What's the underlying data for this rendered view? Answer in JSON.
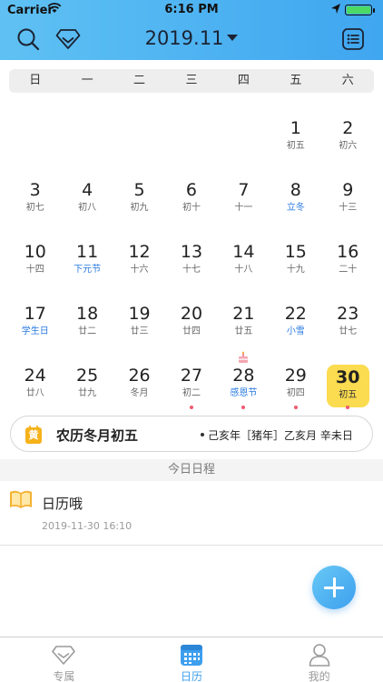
{
  "status_bar": {
    "carrier": "Carrier",
    "time": "6:16 PM"
  },
  "header": {
    "month_title": "2019.11"
  },
  "weekdays": [
    "日",
    "一",
    "二",
    "三",
    "四",
    "五",
    "六"
  ],
  "weeks": [
    [
      {
        "day": "",
        "lunar": ""
      },
      {
        "day": "",
        "lunar": ""
      },
      {
        "day": "",
        "lunar": ""
      },
      {
        "day": "",
        "lunar": ""
      },
      {
        "day": "",
        "lunar": ""
      },
      {
        "day": "1",
        "lunar": "初五"
      },
      {
        "day": "2",
        "lunar": "初六"
      }
    ],
    [
      {
        "day": "3",
        "lunar": "初七"
      },
      {
        "day": "4",
        "lunar": "初八"
      },
      {
        "day": "5",
        "lunar": "初九"
      },
      {
        "day": "6",
        "lunar": "初十"
      },
      {
        "day": "7",
        "lunar": "十一"
      },
      {
        "day": "8",
        "lunar": "立冬",
        "festival": true
      },
      {
        "day": "9",
        "lunar": "十三"
      }
    ],
    [
      {
        "day": "10",
        "lunar": "十四"
      },
      {
        "day": "11",
        "lunar": "下元节",
        "festival": true
      },
      {
        "day": "12",
        "lunar": "十六"
      },
      {
        "day": "13",
        "lunar": "十七"
      },
      {
        "day": "14",
        "lunar": "十八"
      },
      {
        "day": "15",
        "lunar": "十九"
      },
      {
        "day": "16",
        "lunar": "二十"
      }
    ],
    [
      {
        "day": "17",
        "lunar": "学生日",
        "festival": true
      },
      {
        "day": "18",
        "lunar": "廿二"
      },
      {
        "day": "19",
        "lunar": "廿三"
      },
      {
        "day": "20",
        "lunar": "廿四"
      },
      {
        "day": "21",
        "lunar": "廿五"
      },
      {
        "day": "22",
        "lunar": "小雪",
        "festival": true
      },
      {
        "day": "23",
        "lunar": "廿七"
      }
    ],
    [
      {
        "day": "24",
        "lunar": "廿八"
      },
      {
        "day": "25",
        "lunar": "廿九"
      },
      {
        "day": "26",
        "lunar": "冬月"
      },
      {
        "day": "27",
        "lunar": "初二",
        "dot": true
      },
      {
        "day": "28",
        "lunar": "感恩节",
        "festival": true,
        "dot": true,
        "cake": true
      },
      {
        "day": "29",
        "lunar": "初四",
        "dot": true
      },
      {
        "day": "30",
        "lunar": "初五",
        "selected": true,
        "dot": true
      }
    ]
  ],
  "lunar_card": {
    "badge": "黄",
    "title": "农历冬月初五",
    "ganzhi": "己亥年［猪年］乙亥月 辛未日"
  },
  "schedule": {
    "section_label": "今日日程",
    "items": [
      {
        "title": "日历哦",
        "time": "2019-11-30 16:10"
      }
    ]
  },
  "tabbar": {
    "tabs": [
      "专属",
      "日历",
      "我的"
    ],
    "active": 1
  },
  "colors": {
    "accent": "#3d9fee",
    "header_start": "#5fc1f3",
    "selected_day": "#fbdb4f",
    "festival": "#2a7be2",
    "dot": "#ef5a6f"
  },
  "icons": {
    "search": "search-icon",
    "vip": "diamond-icon",
    "list": "list-icon",
    "add": "plus-icon"
  }
}
